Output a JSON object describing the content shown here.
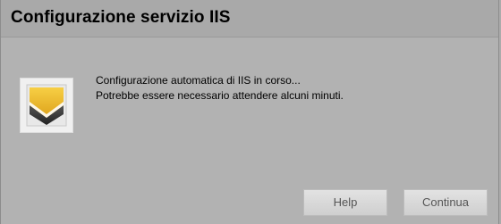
{
  "window": {
    "title": "Configurazione servizio IIS"
  },
  "icon": {
    "name": "setup-shield-icon"
  },
  "message": {
    "line1": "Configurazione automatica di IIS in corso...",
    "line2": "Potrebbe essere necessario attendere alcuni minuti."
  },
  "buttons": {
    "help_label": "Help",
    "continue_label": "Continua"
  },
  "colors": {
    "background": "#b2b2b2",
    "icon_gold": "#e8b020",
    "icon_dark": "#333333"
  }
}
